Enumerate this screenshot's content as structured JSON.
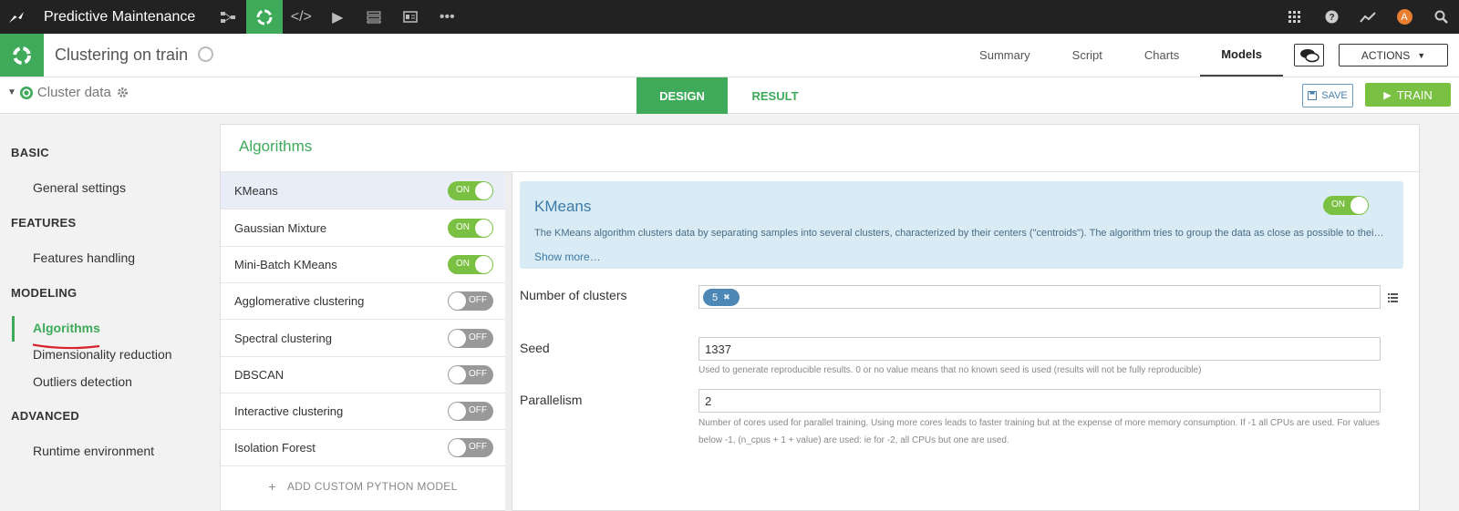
{
  "topnav": {
    "project_name": "Predictive Maintenance",
    "avatar_letter": "A",
    "icons": [
      "flow-icon",
      "lab-icon",
      "code-icon",
      "play-icon",
      "datasets-icon",
      "dashboard-icon",
      "more-icon"
    ],
    "right_icons": [
      "apps-grid-icon",
      "help-icon",
      "trend-icon",
      "avatar",
      "search-icon"
    ]
  },
  "object": {
    "title": "Clustering on train",
    "tabs": [
      "Summary",
      "Script",
      "Charts",
      "Models"
    ],
    "active_tab": "Models",
    "actions_label": "ACTIONS"
  },
  "subheader": {
    "breadcrumb": "Cluster data",
    "design_label": "DESIGN",
    "result_label": "RESULT",
    "save_label": "SAVE",
    "train_label": "TRAIN"
  },
  "sidebar": {
    "sections": [
      {
        "title": "BASIC",
        "items": [
          "General settings"
        ]
      },
      {
        "title": "FEATURES",
        "items": [
          "Features handling"
        ]
      },
      {
        "title": "MODELING",
        "items": [
          "Algorithms",
          "Dimensionality reduction",
          "Outliers detection"
        ]
      },
      {
        "title": "ADVANCED",
        "items": [
          "Runtime environment"
        ]
      }
    ],
    "active_item": "Algorithms"
  },
  "algorithms": {
    "title": "Algorithms",
    "list": [
      {
        "name": "KMeans",
        "state": "ON"
      },
      {
        "name": "Gaussian Mixture",
        "state": "ON"
      },
      {
        "name": "Mini-Batch KMeans",
        "state": "ON"
      },
      {
        "name": "Agglomerative clustering",
        "state": "OFF"
      },
      {
        "name": "Spectral clustering",
        "state": "OFF"
      },
      {
        "name": "DBSCAN",
        "state": "OFF"
      },
      {
        "name": "Interactive clustering",
        "state": "OFF"
      },
      {
        "name": "Isolation Forest",
        "state": "OFF"
      }
    ],
    "add_custom_label": "ADD CUSTOM PYTHON MODEL"
  },
  "detail": {
    "title": "KMeans",
    "toggle": "ON",
    "description": "The KMeans algorithm clusters data by separating samples into several clusters, characterized by their centers (\"centroids\"). The algorithm tries to group the data as close as possible to their centroids.",
    "show_more": "Show more…",
    "params": {
      "clusters_label": "Number of clusters",
      "clusters_value": "5",
      "clusters_remove": "✖",
      "seed_label": "Seed",
      "seed_value": "1337",
      "seed_help": "Used to generate reproducible results. 0 or no value means that no known seed is used (results will not be fully reproducible)",
      "parallelism_label": "Parallelism",
      "parallelism_value": "2",
      "parallelism_help": "Number of cores used for parallel training. Using more cores leads to faster training but at the expense of more memory consumption. If -1 all CPUs are used. For values below -1, (n_cpus + 1 + value) are used: ie for -2, all CPUs but one are used."
    }
  }
}
